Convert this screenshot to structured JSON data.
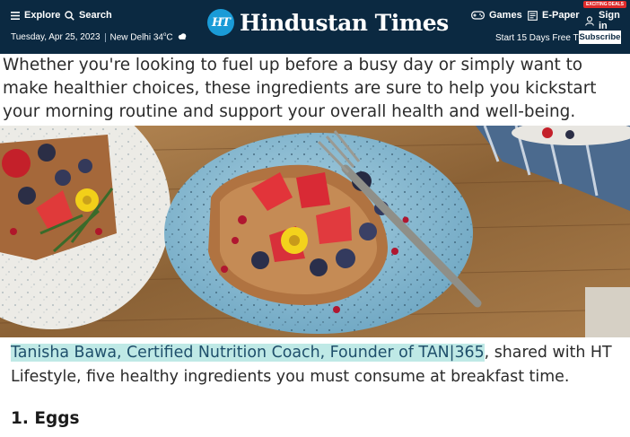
{
  "header": {
    "explore_label": "Explore",
    "search_label": "Search",
    "date": "Tuesday, Apr 25, 2023",
    "weather": "New Delhi 34",
    "weather_unit": "C",
    "brand_badge": "HT",
    "brand_name": "Hindustan Times",
    "games_label": "Games",
    "epaper_label": "E-Paper",
    "signin_label": "Sign in",
    "deals_badge": "EXCITING DEALS",
    "trial_text": "Start 15 Days Free Trial",
    "subscribe_label": "Subscribe",
    "background_color": "#0b2941",
    "accent_color": "#1a9bd7"
  },
  "article": {
    "paragraph_1": "Whether you're looking to fuel up before a busy day or simply want to make healthier choices, these ingredients are sure to help you kickstart your morning routine and support your overall health and well-being.",
    "image_subject": "toast with strawberries, blueberries and pomegranate on a blue plate",
    "paragraph_2_highlight": "Tanisha Bawa, Certified Nutrition Coach, Founder of TAN|365",
    "paragraph_2_rest": ", shared with HT Lifestyle, five healthy ingredients you must consume at breakfast time.",
    "highlight_color": "#bfe9e6",
    "heading_1": "1. Eggs"
  },
  "icons": [
    "menu-icon",
    "search-icon",
    "weather-cloud-icon",
    "gamepad-icon",
    "newspaper-icon",
    "user-icon",
    "fork-icon"
  ]
}
